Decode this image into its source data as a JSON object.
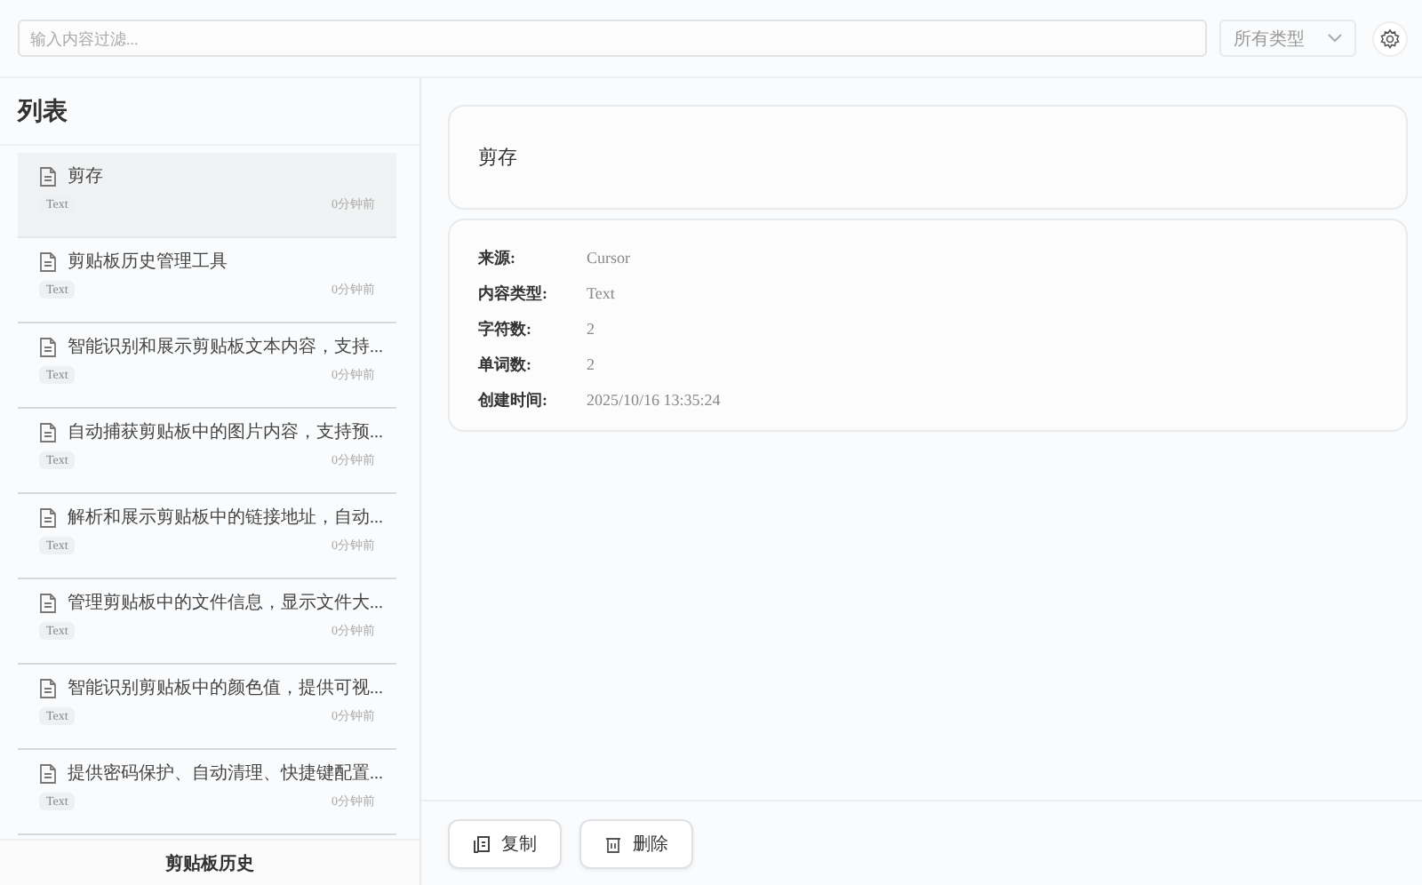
{
  "search": {
    "placeholder": "输入内容过滤..."
  },
  "type_filter": {
    "value": "所有类型"
  },
  "list": {
    "title": "列表",
    "items": [
      {
        "text": "剪存",
        "tag": "Text",
        "time": "0分钟前",
        "selected": true
      },
      {
        "text": "剪贴板历史管理工具",
        "tag": "Text",
        "time": "0分钟前",
        "selected": false
      },
      {
        "text": "智能识别和展示剪贴板文本内容，支持...",
        "tag": "Text",
        "time": "0分钟前",
        "selected": false
      },
      {
        "text": "自动捕获剪贴板中的图片内容，支持预...",
        "tag": "Text",
        "time": "0分钟前",
        "selected": false
      },
      {
        "text": "解析和展示剪贴板中的链接地址，自动...",
        "tag": "Text",
        "time": "0分钟前",
        "selected": false
      },
      {
        "text": "管理剪贴板中的文件信息，显示文件大...",
        "tag": "Text",
        "time": "0分钟前",
        "selected": false
      },
      {
        "text": "智能识别剪贴板中的颜色值，提供可视...",
        "tag": "Text",
        "time": "0分钟前",
        "selected": false
      },
      {
        "text": "提供密码保护、自动清理、快捷键配置...",
        "tag": "Text",
        "time": "0分钟前",
        "selected": false
      }
    ],
    "footer": "剪贴板历史"
  },
  "detail": {
    "content": "剪存",
    "info": [
      {
        "label": "来源:",
        "value": "Cursor"
      },
      {
        "label": "内容类型:",
        "value": "Text"
      },
      {
        "label": "字符数:",
        "value": "2"
      },
      {
        "label": "单词数:",
        "value": "2"
      },
      {
        "label": "创建时间:",
        "value": "2025/10/16 13:35:24"
      }
    ],
    "buttons": [
      {
        "kind": "copy",
        "label": "复制"
      },
      {
        "kind": "delete",
        "label": "删除"
      }
    ]
  }
}
